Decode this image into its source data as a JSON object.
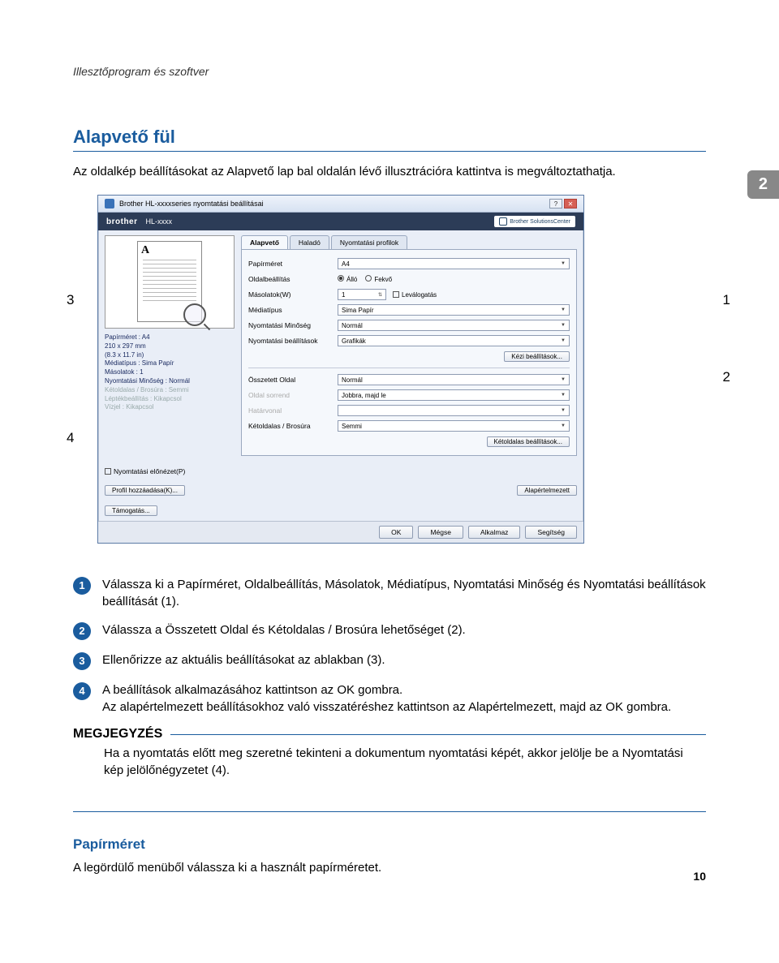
{
  "header": "Illesztőprogram és szoftver",
  "chapter_number": "2",
  "section_title": "Alapvető fül",
  "intro": "Az oldalkép beállításokat az Alapvető lap bal oldalán lévő illusztrációra kattintva is megváltoztathatja.",
  "callouts": {
    "c1": "1",
    "c2": "2",
    "c3": "3",
    "c4": "4"
  },
  "win": {
    "title": "Brother HL-xxxxseries nyomtatási beállításai",
    "help_btn": "?",
    "close_btn": "✕",
    "brand": "brother",
    "model": "HL-xxxx",
    "solutions": "Brother SolutionsCenter",
    "preview_letter": "A",
    "summary": {
      "l1": "Papírméret : A4",
      "l2": "210 x 297 mm",
      "l3": "(8.3 x 11.7 in)",
      "l4": "Médiatípus : Sima Papír",
      "l5": "Másolatok : 1",
      "l6": "Nyomtatási Minőség : Normál",
      "l7": "Kétoldalas / Brosúra : Semmi",
      "l8": "Léptékbeállítás : Kikapcsol",
      "l9": "Vízjel : Kikapcsol"
    },
    "tabs": {
      "t1": "Alapvető",
      "t2": "Haladó",
      "t3": "Nyomtatási profilok"
    },
    "rows": {
      "papersize_lbl": "Papírméret",
      "papersize_val": "A4",
      "orient_lbl": "Oldalbeállítás",
      "orient_a": "Álló",
      "orient_b": "Fekvő",
      "copies_lbl": "Másolatok(W)",
      "copies_val": "1",
      "collate": "Leválogatás",
      "media_lbl": "Médiatípus",
      "media_val": "Sima Papír",
      "qual_lbl": "Nyomtatási Minőség",
      "qual_val": "Normál",
      "pset_lbl": "Nyomtatási beállítások",
      "pset_val": "Grafikák",
      "manual_btn": "Kézi beállítások...",
      "multi_lbl": "Összetett Oldal",
      "multi_val": "Normál",
      "order_lbl": "Oldal sorrend",
      "order_val": "Jobbra, majd le",
      "border_lbl": "Határvonal",
      "duplex_lbl": "Kétoldalas / Brosúra",
      "duplex_val": "Semmi",
      "duplex_btn": "Kétoldalas beállítások..."
    },
    "bottom": {
      "preview_chk": "Nyomtatási előnézet(P)",
      "addprofile": "Profil hozzáadása(K)...",
      "default": "Alapértelmezett",
      "support": "Támogatás..."
    },
    "footer": {
      "ok": "OK",
      "cancel": "Mégse",
      "apply": "Alkalmaz",
      "help": "Segítség"
    }
  },
  "steps": {
    "s1": "Válassza ki a Papírméret, Oldalbeállítás, Másolatok, Médiatípus, Nyomtatási Minőség és Nyomtatási beállítások beállítását (1).",
    "s2": "Válassza a Összetett Oldal és Kétoldalas / Brosúra lehetőséget (2).",
    "s3": "Ellenőrizze az aktuális beállításokat az ablakban (3).",
    "s4a": "A beállítások alkalmazásához kattintson az OK gombra.",
    "s4b": "Az alapértelmezett beállításokhoz való visszatéréshez kattintson az Alapértelmezett, majd az OK gombra."
  },
  "note_head": "MEGJEGYZÉS",
  "note_body": "Ha a nyomtatás előtt meg szeretné tekinteni a dokumentum nyomtatási képét, akkor jelölje be a Nyomtatási kép jelölőnégyzetet (4).",
  "sub_head": "Papírméret",
  "sub_text": "A legördülő menüből válassza ki a használt papírméretet.",
  "page_num": "10"
}
